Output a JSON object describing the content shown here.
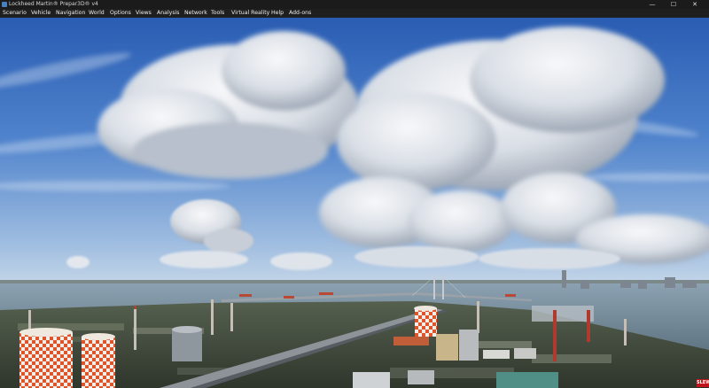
{
  "window": {
    "title": "Lockheed Martin® Prepar3D® v4",
    "minimize_glyph": "—",
    "maximize_glyph": "☐",
    "close_glyph": "✕"
  },
  "menu": {
    "items": [
      "Scenario",
      "Vehicle",
      "Navigation",
      "World",
      "Options",
      "Views",
      "Analysis",
      "Network",
      "Tools",
      "Virtual Reality",
      "Help",
      "Add-ons"
    ]
  },
  "status": {
    "slew_label": "SLEW",
    "slew_color": "#c0151a"
  },
  "colors": {
    "sky_top": "#2f63b8",
    "sky_horizon": "#a9c4e2",
    "sea": "#6f8694",
    "city": "#434b40"
  }
}
